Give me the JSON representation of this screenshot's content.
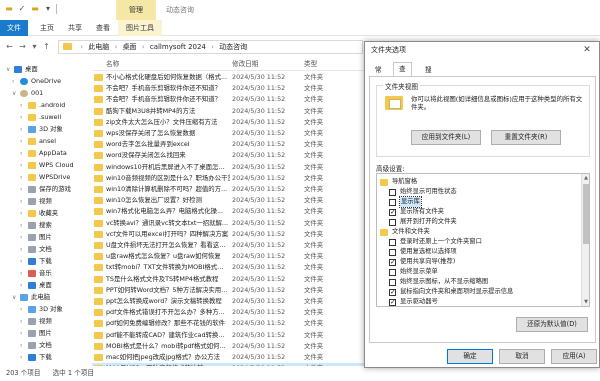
{
  "explorer": {
    "context_tab": "管理",
    "window_title": "动态咨询",
    "ribbon_tabs": [
      "文件",
      "主页",
      "共享",
      "查看",
      "图片工具"
    ],
    "address": {
      "crumbs": [
        "此电脑",
        "桌面",
        "callmysoft 2024",
        "动态咨询"
      ]
    },
    "columns": {
      "name": "名称",
      "date": "修改日期",
      "type": "类型"
    },
    "nav_items": [
      {
        "label": "桌面",
        "icon": "desktop-icon"
      },
      {
        "label": "OneDrive",
        "icon": "cloud-icon"
      },
      {
        "label": "001",
        "icon": "user-icon"
      },
      {
        "label": ".android",
        "icon": "folder-icon"
      },
      {
        "label": ".suwell",
        "icon": "folder-icon"
      },
      {
        "label": "3D 对象",
        "icon": "3d-objects-icon"
      },
      {
        "label": "ansel",
        "icon": "folder-icon"
      },
      {
        "label": "AppData",
        "icon": "folder-icon"
      },
      {
        "label": "WPS Cloud",
        "icon": "folder-icon"
      },
      {
        "label": "WPSDrive",
        "icon": "folder-icon"
      },
      {
        "label": "保存的游戏",
        "icon": "saved-games-icon"
      },
      {
        "label": "视频",
        "icon": "video-icon"
      },
      {
        "label": "收藏夹",
        "icon": "favorites-icon"
      },
      {
        "label": "搜索",
        "icon": "search-icon"
      },
      {
        "label": "图片",
        "icon": "pictures-icon"
      },
      {
        "label": "文档",
        "icon": "documents-icon"
      },
      {
        "label": "下载",
        "icon": "downloads-icon"
      },
      {
        "label": "音乐",
        "icon": "music-icon"
      },
      {
        "label": "桌面",
        "icon": "desktop-icon"
      },
      {
        "label": "此电脑",
        "icon": "pc-icon"
      },
      {
        "label": "3D 对象",
        "icon": "3d-objects-icon"
      },
      {
        "label": "视频",
        "icon": "video-icon"
      },
      {
        "label": "图片",
        "icon": "pictures-icon"
      },
      {
        "label": "文档",
        "icon": "documents-icon"
      },
      {
        "label": "下载",
        "icon": "downloads-icon"
      },
      {
        "label": "音乐",
        "icon": "music-icon"
      },
      {
        "label": "桌面",
        "icon": "desktop-icon"
      }
    ],
    "files": [
      {
        "name": "不小心格式化硬盘后如何恢复数据（格式...",
        "date": "2024/5/30 11:52",
        "type": "文件夹"
      },
      {
        "name": "不会吧？手机音乐剪辑软件你还不知道？",
        "date": "2024/5/30 11:52",
        "type": "文件夹"
      },
      {
        "name": "不会吧？手机音乐剪辑软件你还不知道？",
        "date": "2024/5/30 11:52",
        "type": "文件夹"
      },
      {
        "name": "酷狗下载M3U8并转MP4的方法",
        "date": "2024/5/30 11:52",
        "type": "文件夹"
      },
      {
        "name": "zip文件太大怎么压小？文件压缩有方法",
        "date": "2024/5/30 11:52",
        "type": "文件夹"
      },
      {
        "name": "wps没保存关闭了怎么恢复数据",
        "date": "2024/5/30 11:52",
        "type": "文件夹"
      },
      {
        "name": "word去字怎么批量弄到excel",
        "date": "2024/5/30 11:52",
        "type": "文件夹"
      },
      {
        "name": "word没保存关闭怎么找回来",
        "date": "2024/5/30 11:52",
        "type": "文件夹"
      },
      {
        "name": "windows10开机后黑屏进入不了桌面怎...",
        "date": "2024/5/30 11:52",
        "type": "文件夹"
      },
      {
        "name": "win10音频视频的区别是什么？职场办公干货",
        "date": "2024/5/30 11:52",
        "type": "文件夹"
      },
      {
        "name": "win10清除计算机删除不可吗？超值的方...",
        "date": "2024/5/30 11:52",
        "type": "文件夹"
      },
      {
        "name": "win10怎么恢复出厂设置？好检测",
        "date": "2024/5/30 11:52",
        "type": "文件夹"
      },
      {
        "name": "win7格式化电脑怎么弄？电脑格式化操...",
        "date": "2024/5/30 11:52",
        "type": "文件夹"
      },
      {
        "name": "vc转换avi？通讯录vc转文本txt一招就解...",
        "date": "2024/5/30 11:52",
        "type": "文件夹"
      },
      {
        "name": "vcf文件可以用excel打开吗？四种解决方案",
        "date": "2024/5/30 11:52",
        "type": "文件夹"
      },
      {
        "name": "U盘文件损坏无法打开怎么恢复？看看这...",
        "date": "2024/5/30 11:52",
        "type": "文件夹"
      },
      {
        "name": "u盘raw格式怎么恢复？u盘raw如何恢复",
        "date": "2024/5/30 11:52",
        "type": "文件夹"
      },
      {
        "name": "txt转mobi？TXT文件转换为MOBI格式...",
        "date": "2024/5/30 11:52",
        "type": "文件夹"
      },
      {
        "name": "TS是什么格式文件及TS转MP4格式教程",
        "date": "2024/5/30 11:52",
        "type": "文件夹"
      },
      {
        "name": "PPT如何转Word文档？5种方法解决实用...",
        "date": "2024/5/30 11:52",
        "type": "文件夹"
      },
      {
        "name": "ppt怎么转换成word？演示文稿转换教程",
        "date": "2024/5/30 11:52",
        "type": "文件夹"
      },
      {
        "name": "pdf文件格式错误打不开怎么办？多种方...",
        "date": "2024/5/30 11:52",
        "type": "文件夹"
      },
      {
        "name": "pdf如何免费编辑修改？那些不花钱的软件",
        "date": "2024/5/30 11:52",
        "type": "文件夹"
      },
      {
        "name": "pdf能不能转成CAD？建筑作业cad转换...",
        "date": "2024/5/30 11:52",
        "type": "文件夹"
      },
      {
        "name": "MOBI格式是什么？mobi转pdf格式如何...",
        "date": "2024/5/30 11:52",
        "type": "文件夹"
      },
      {
        "name": "mac如何把jpeg改成jpg格式？办公方法",
        "date": "2024/5/30 11:52",
        "type": "文件夹"
      },
      {
        "name": "M4A与MP3：两种音频格式的比较",
        "date": "2024/5/30 11:52",
        "type": "文件夹"
      }
    ],
    "status": {
      "count": "203 个项目",
      "selected": "选中 1 个项目"
    }
  },
  "dialog": {
    "title": "文件夹选项",
    "tabs": [
      "常规",
      "查看",
      "搜索"
    ],
    "folder_views": {
      "legend": "文件夹视图",
      "description": "你可以将此视图(如详细信息或图标)应用于这种类型的所有文件夹。",
      "apply_btn": "应用到文件夹(L)",
      "reset_btn": "重置文件夹(R)"
    },
    "advanced_label": "高级设置:",
    "advanced_items": [
      {
        "label": "导航窗格",
        "kind": "category",
        "level": 0
      },
      {
        "label": "始终显示可用性状态",
        "kind": "check",
        "checked": false,
        "level": 1
      },
      {
        "label": "显示库",
        "kind": "check",
        "checked": false,
        "level": 1,
        "highlight": true
      },
      {
        "label": "显示所有文件夹",
        "kind": "check",
        "checked": true,
        "level": 1
      },
      {
        "label": "展开到打开的文件夹",
        "kind": "check",
        "checked": false,
        "level": 1
      },
      {
        "label": "文件和文件夹",
        "kind": "category",
        "level": 0
      },
      {
        "label": "登录时还原上一个文件夹窗口",
        "kind": "check",
        "checked": false,
        "level": 1
      },
      {
        "label": "使用复选框以选择项",
        "kind": "check",
        "checked": false,
        "level": 1
      },
      {
        "label": "使用共享向导(推荐)",
        "kind": "check",
        "checked": true,
        "level": 1
      },
      {
        "label": "始终显示菜单",
        "kind": "check",
        "checked": false,
        "level": 1
      },
      {
        "label": "始终显示图标，从不显示缩略图",
        "kind": "check",
        "checked": false,
        "level": 1
      },
      {
        "label": "鼠标指向文件夹和桌面项时显示提示信息",
        "kind": "check",
        "checked": true,
        "level": 1
      },
      {
        "label": "显示驱动器号",
        "kind": "check",
        "checked": true,
        "level": 1
      }
    ],
    "restore_btn": "还原为默认值(D)",
    "ok_btn": "确定",
    "cancel_btn": "取消",
    "apply_btn": "应用(A)"
  }
}
